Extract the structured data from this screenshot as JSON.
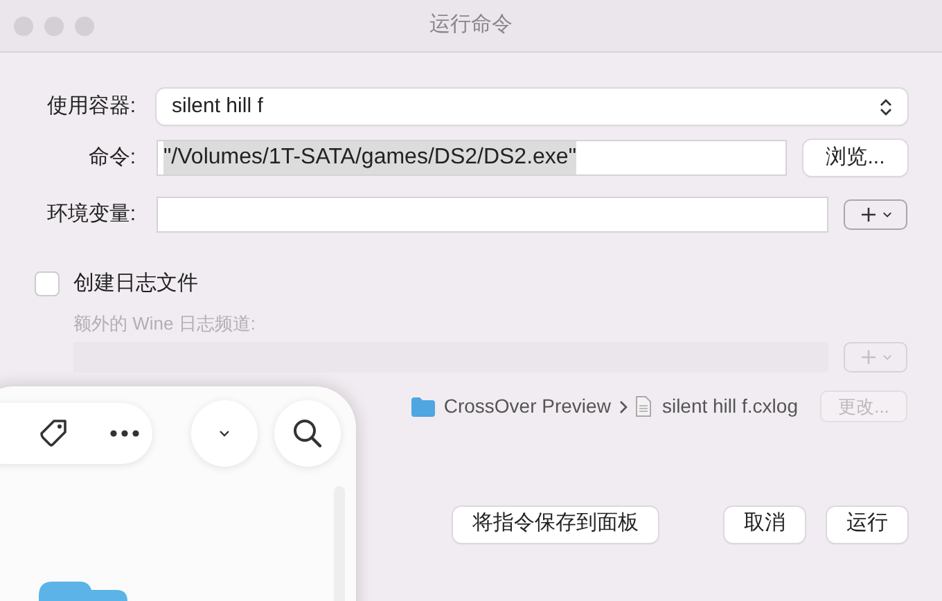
{
  "window": {
    "title": "运行命令"
  },
  "container": {
    "label": "使用容器:",
    "value": "silent hill f"
  },
  "command": {
    "label": "命令:",
    "value": "\"/Volumes/1T-SATA/games/DS2/DS2.exe\"",
    "selected": true,
    "browse": "浏览..."
  },
  "environment": {
    "label": "环境变量:",
    "add_disabled": false
  },
  "create_log": {
    "label": "创建日志文件",
    "checked": false
  },
  "wine_channels": {
    "label": "额外的 Wine 日志频道:",
    "disabled": true
  },
  "log_path": {
    "crumbs": [
      {
        "kind": "folder",
        "label": "CrossOver Preview"
      },
      {
        "kind": "file",
        "label": "silent hill f.cxlog"
      }
    ],
    "change": "更改...",
    "change_disabled": true
  },
  "buttons": [
    {
      "label": "将指令保存到面板"
    },
    {
      "label": "取消"
    },
    {
      "label": "运行"
    }
  ]
}
